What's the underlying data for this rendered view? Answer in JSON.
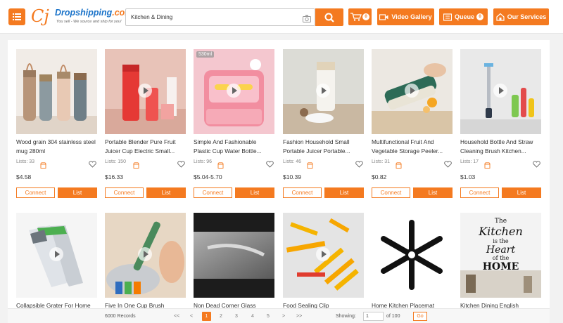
{
  "header": {
    "logo_mark": "Cj",
    "logo_name": "Dropshipping",
    "logo_domain": ".com",
    "logo_tagline": "You sell - We source and ship for you!",
    "search_value": "Kitchen & Dining",
    "cart_badge": "0",
    "video_gallery_label": "Video Gallery",
    "queue_label": "Queue",
    "queue_badge": "0",
    "services_label": "Our Services"
  },
  "labels": {
    "connect": "Connect",
    "list": "List"
  },
  "products": [
    {
      "title": "Wood grain 304 stainless steel mug 280ml",
      "lists": "Lists: 33",
      "price": "$4.58",
      "has_video": false
    },
    {
      "title": "Portable Blender Pure Fruit Juicer Cup Electric Small...",
      "lists": "Lists: 150",
      "price": "$16.33",
      "has_video": true
    },
    {
      "title": "Simple And Fashionable Plastic Cup Water Bottle...",
      "lists": "Lists: 96",
      "price": "$5.04-5.70",
      "has_video": true,
      "thumb_badge": "530ml"
    },
    {
      "title": "Fashion Household Small Portable Juicer Portable...",
      "lists": "Lists: 46",
      "price": "$10.39",
      "has_video": true
    },
    {
      "title": "Multifunctional Fruit And Vegetable Storage Peeler...",
      "lists": "Lists: 31",
      "price": "$0.82",
      "has_video": true
    },
    {
      "title": "Household Bottle And Straw Cleaning Brush Kitchen...",
      "lists": "Lists: 17",
      "price": "$1.03",
      "has_video": true
    },
    {
      "title": "Collapsible Grater For Home",
      "has_video": true
    },
    {
      "title": "Five In One Cup Brush",
      "has_video": true
    },
    {
      "title": "Non Dead Corner Glass",
      "has_video": false
    },
    {
      "title": "Food Sealing Clip",
      "has_video": true
    },
    {
      "title": "Home Kitchen Placemat",
      "has_video": false
    },
    {
      "title": "Kitchen Dining English",
      "has_video": false,
      "thumb_text": [
        "The",
        "Kitchen",
        "is the",
        "Heart",
        "of the",
        "HOME"
      ]
    }
  ],
  "pagination": {
    "records": "6000 Records",
    "first": "<<",
    "prev": "<",
    "pages": [
      "1",
      "2",
      "3",
      "4",
      "5"
    ],
    "next": ">",
    "last": ">>",
    "showing_label": "Showing:",
    "showing_value": "1",
    "of_label": "of 100",
    "go_label": "Go"
  },
  "colors": {
    "accent": "#f47a20",
    "brand_blue": "#1a73c9"
  }
}
